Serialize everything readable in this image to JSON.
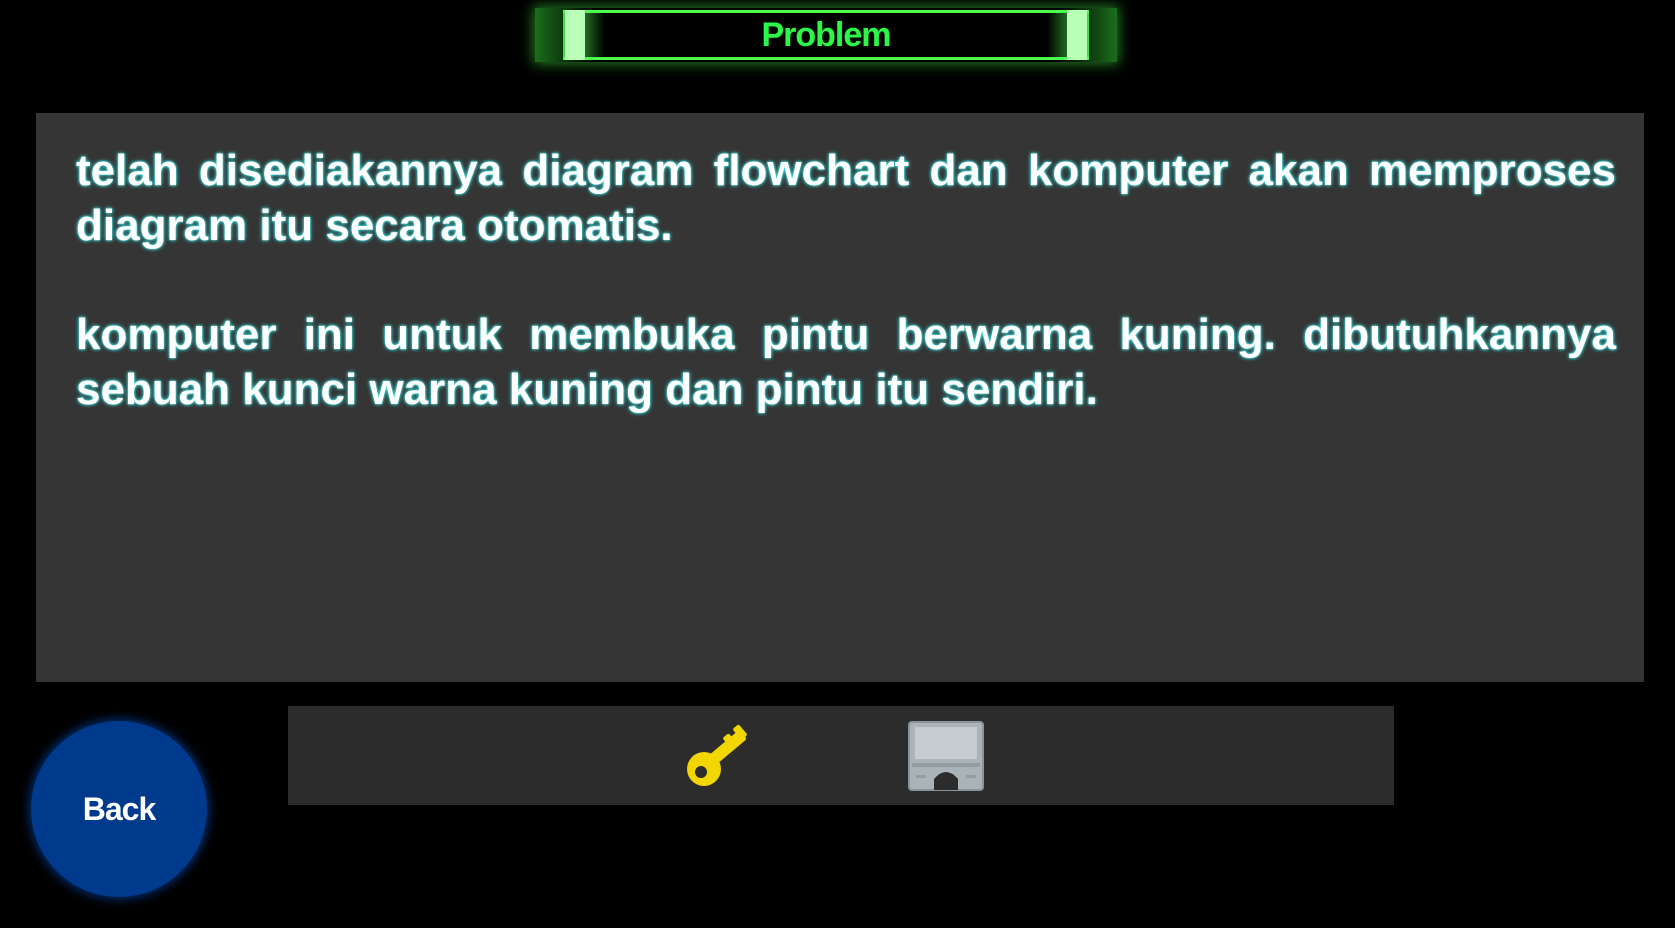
{
  "header": {
    "title": "Problem"
  },
  "problem": {
    "paragraphs": [
      "telah disediakannya diagram flowchart dan komputer akan memproses diagram itu secara otomatis.",
      "komputer ini untuk membuka pintu berwarna kuning. dibutuhkannya sebuah kunci warna kuning dan pintu itu sendiri."
    ]
  },
  "inventory": {
    "items": [
      {
        "icon": "key-icon",
        "color": "#f2d600"
      },
      {
        "icon": "door-icon",
        "color": "#a9b3b8"
      }
    ]
  },
  "controls": {
    "back_label": "Back"
  },
  "colors": {
    "title_green": "#2ef54a",
    "panel": "#353535",
    "text_glow": "#3ce6e6",
    "back_button": "#003a8c"
  }
}
